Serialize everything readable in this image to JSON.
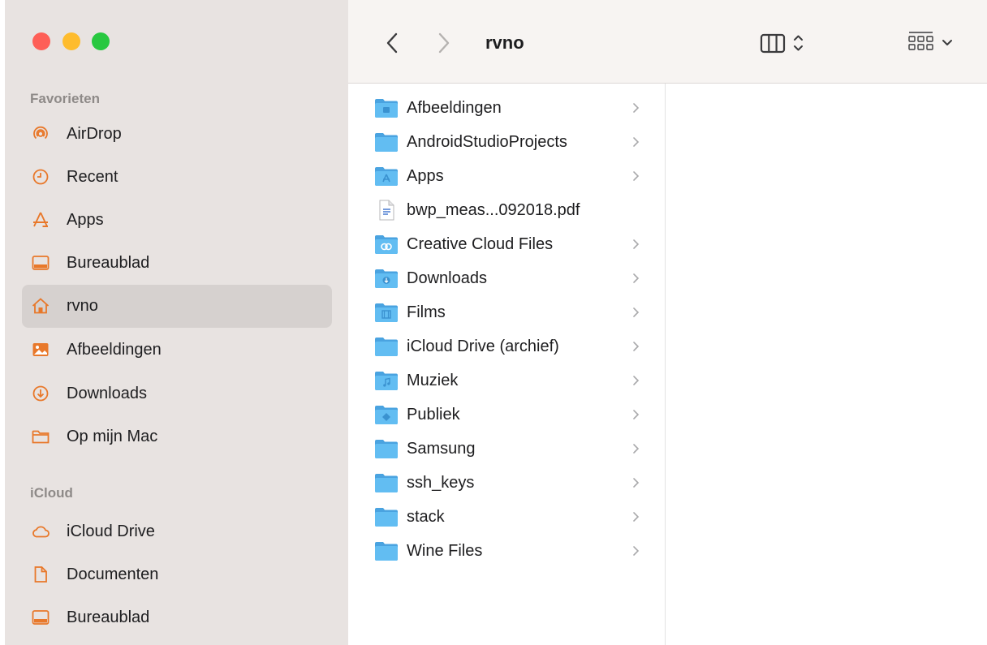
{
  "toolbar": {
    "title": "rvno",
    "back_icon": "chevron-left-icon",
    "forward_icon": "chevron-right-icon",
    "view_icon": "columns-view-icon",
    "group_icon": "grid-group-icon"
  },
  "sidebar": {
    "sections": [
      {
        "label": "Favorieten",
        "items": [
          {
            "label": "AirDrop",
            "icon": "airdrop-icon"
          },
          {
            "label": "Recent",
            "icon": "clock-icon"
          },
          {
            "label": "Apps",
            "icon": "apps-icon"
          },
          {
            "label": "Bureaublad",
            "icon": "desktop-icon"
          },
          {
            "label": "rvno",
            "icon": "home-icon",
            "selected": true
          },
          {
            "label": "Afbeeldingen",
            "icon": "photo-icon"
          },
          {
            "label": "Downloads",
            "icon": "download-icon"
          },
          {
            "label": "Op mijn Mac",
            "icon": "folder-outline-icon"
          }
        ]
      },
      {
        "label": "iCloud",
        "items": [
          {
            "label": "iCloud Drive",
            "icon": "cloud-icon"
          },
          {
            "label": "Documenten",
            "icon": "document-icon"
          },
          {
            "label": "Bureaublad",
            "icon": "desktop-icon"
          }
        ]
      }
    ]
  },
  "files": [
    {
      "name": "Afbeeldingen",
      "kind": "folder",
      "badge": "photo"
    },
    {
      "name": "AndroidStudioProjects",
      "kind": "folder"
    },
    {
      "name": "Apps",
      "kind": "folder",
      "badge": "apps"
    },
    {
      "name": "bwp_meas...092018.pdf",
      "kind": "pdf"
    },
    {
      "name": "Creative Cloud Files",
      "kind": "folder",
      "badge": "cc"
    },
    {
      "name": "Downloads",
      "kind": "folder",
      "badge": "download"
    },
    {
      "name": "Films",
      "kind": "folder",
      "badge": "film"
    },
    {
      "name": "iCloud Drive (archief)",
      "kind": "folder"
    },
    {
      "name": "Muziek",
      "kind": "folder",
      "badge": "music"
    },
    {
      "name": "Publiek",
      "kind": "folder",
      "badge": "public"
    },
    {
      "name": "Samsung",
      "kind": "folder"
    },
    {
      "name": "ssh_keys",
      "kind": "folder"
    },
    {
      "name": "stack",
      "kind": "folder"
    },
    {
      "name": "Wine Files",
      "kind": "folder"
    }
  ],
  "colors": {
    "sidebar_bg": "#e8e3e1",
    "selected_bg": "#d6d1cf",
    "accent_orange": "#e8782a",
    "folder_blue": "#5ab7ee",
    "close": "#fe5f57",
    "minimize": "#febc2e",
    "zoom": "#28c840"
  }
}
